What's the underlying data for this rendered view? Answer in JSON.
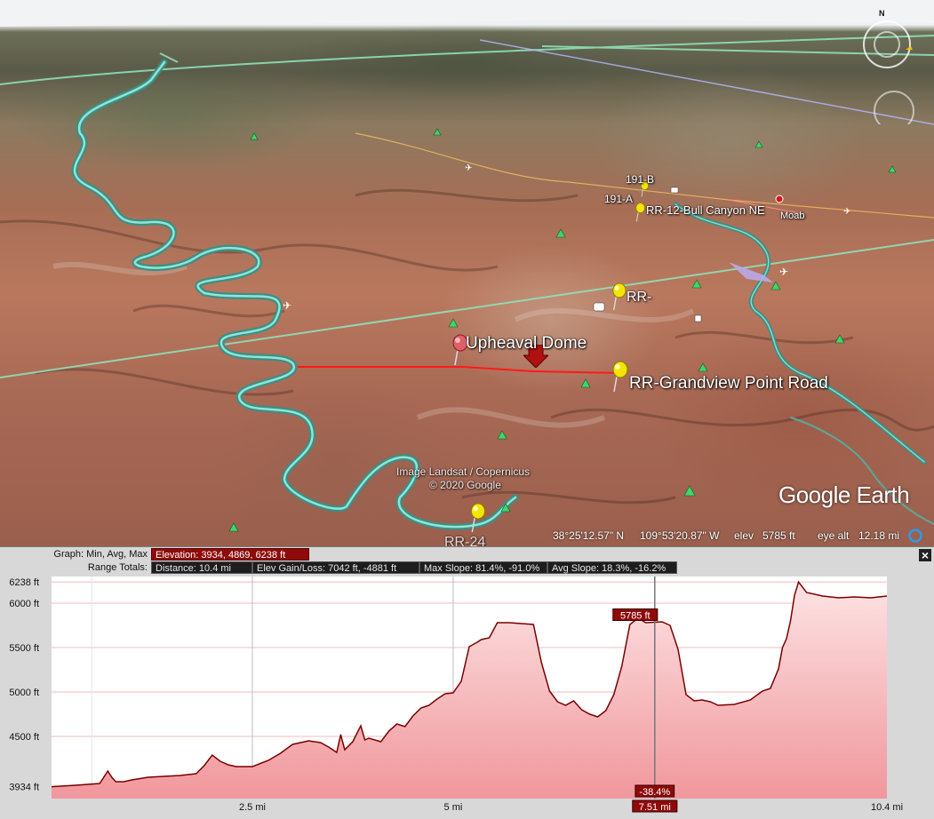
{
  "map": {
    "labels": {
      "upheaval_dome": "Upheaval Dome",
      "grandview": "RR-Grandview Point Road",
      "rr_short": "RR-",
      "bull_canyon": "RR-12-Bull Canyon NE",
      "moab": "Moab",
      "r191b": "191-B",
      "r191a": "191-A",
      "rr24": "RR-24",
      "attribution_1": "Image Landsat / Copernicus",
      "attribution_2": "© 2020 Google"
    },
    "status": {
      "latitude": "38°25'12.57\" N",
      "longitude": "109°53'20.87\" W",
      "elev_label": "elev",
      "elev_value": "5785 ft",
      "eye_alt_label": "eye alt",
      "eye_alt_value": "12.18 mi"
    },
    "brand": "Google Earth",
    "north_label": "N",
    "colors": {
      "route": "#ff1a1a",
      "river": "#57c6b6",
      "pin_yellow": "#f2e600",
      "pin_red": "#e0606a"
    }
  },
  "panel": {
    "graph_label": "Graph: Min, Avg, Max",
    "elevation_stat": "Elevation: 3934, 4869, 6238 ft",
    "range_totals_label": "Range Totals:",
    "distance_stat": "Distance: 10.4 mi",
    "gain_loss_stat": "Elev Gain/Loss: 7042 ft, -4881 ft",
    "max_slope_stat": "Max Slope: 81.4%, -91.0%",
    "avg_slope_stat": "Avg Slope: 18.3%, -16.2%",
    "close_label": "×",
    "cursor_elev_label": "5785 ft",
    "cursor_slope_label": "-38.4%",
    "cursor_dist_label": "7.51 mi"
  },
  "chart_data": {
    "type": "area",
    "title": "",
    "xlabel": "",
    "ylabel": "",
    "x_unit": "mi",
    "y_unit": "ft",
    "xlim": [
      0,
      10.4
    ],
    "ylim": [
      3800,
      6300
    ],
    "y_ticks": [
      {
        "value": 3934,
        "label": "3934 ft"
      },
      {
        "value": 4500,
        "label": "4500 ft"
      },
      {
        "value": 5000,
        "label": "5000 ft"
      },
      {
        "value": 5500,
        "label": "5500 ft"
      },
      {
        "value": 6000,
        "label": "6000 ft"
      },
      {
        "value": 6238,
        "label": "6238 ft"
      }
    ],
    "x_ticks": [
      {
        "value": 2.5,
        "label": "2.5 mi"
      },
      {
        "value": 5,
        "label": "5 mi"
      },
      {
        "value": 10.4,
        "label": "10.4 mi"
      }
    ],
    "cursor": {
      "x": 7.51,
      "y": 5785
    },
    "grid": true,
    "line_color": "#7a0000",
    "fill_color": "#f2a4a8",
    "series": [
      {
        "x": [
          0.0,
          0.3,
          0.6,
          0.7,
          0.75,
          0.8,
          0.9,
          1.0,
          1.2,
          1.4,
          1.6,
          1.8,
          1.9,
          2.0,
          2.1,
          2.2,
          2.3,
          2.5,
          2.7,
          2.85,
          3.0,
          3.2,
          3.35,
          3.45,
          3.55,
          3.6,
          3.65,
          3.75,
          3.85,
          3.9,
          3.95,
          4.1,
          4.2,
          4.3,
          4.4,
          4.5,
          4.6,
          4.7,
          4.8,
          4.9,
          5.0,
          5.1,
          5.2,
          5.3,
          5.35,
          5.45,
          5.55,
          5.7,
          5.85,
          6.0,
          6.1,
          6.2,
          6.3,
          6.4,
          6.5,
          6.6,
          6.7,
          6.8,
          6.9,
          7.0,
          7.1,
          7.2,
          7.3,
          7.4,
          7.5,
          7.6,
          7.7,
          7.8,
          7.9,
          8.0,
          8.1,
          8.2,
          8.3,
          8.5,
          8.7,
          8.85,
          8.95,
          9.05,
          9.1,
          9.15,
          9.2,
          9.25,
          9.3,
          9.4,
          9.6,
          9.8,
          10.0,
          10.2,
          10.4
        ],
        "y": [
          3934,
          3950,
          3970,
          4110,
          4040,
          3990,
          3990,
          4010,
          4040,
          4050,
          4060,
          4080,
          4170,
          4290,
          4220,
          4180,
          4160,
          4160,
          4230,
          4310,
          4410,
          4450,
          4430,
          4380,
          4320,
          4520,
          4350,
          4440,
          4620,
          4460,
          4480,
          4440,
          4560,
          4640,
          4610,
          4730,
          4820,
          4850,
          4920,
          4980,
          4990,
          5120,
          5510,
          5560,
          5590,
          5610,
          5780,
          5780,
          5770,
          5760,
          5330,
          5010,
          4890,
          4850,
          4900,
          4800,
          4750,
          4720,
          4790,
          4970,
          5290,
          5760,
          5830,
          5780,
          5785,
          5790,
          5750,
          5480,
          4970,
          4900,
          4910,
          4890,
          4850,
          4860,
          4910,
          5010,
          5040,
          5260,
          5500,
          5600,
          5800,
          6090,
          6238,
          6120,
          6080,
          6060,
          6070,
          6060,
          6080
        ]
      }
    ]
  }
}
